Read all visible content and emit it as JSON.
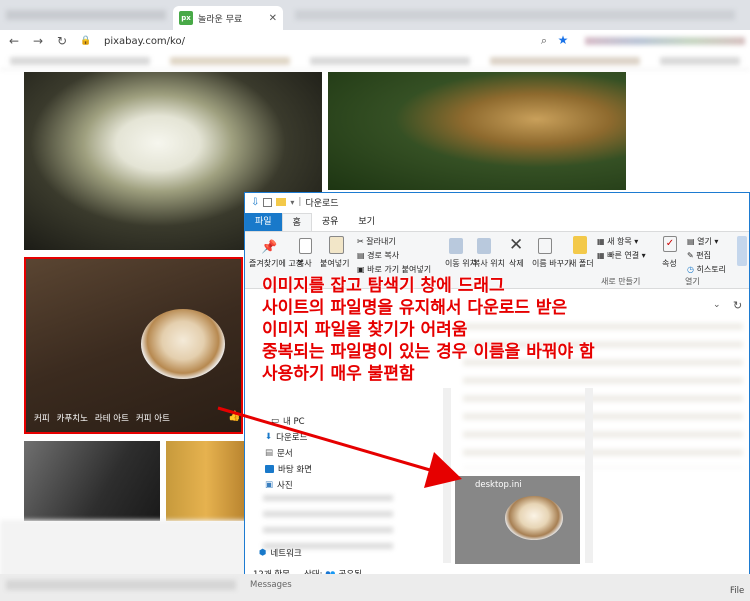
{
  "browser": {
    "tab_title": "놀라운 무료",
    "favicon_text": "px",
    "url": "pixabay.com/ko/"
  },
  "images": {
    "coffee_tags": [
      "커피",
      "카푸치노",
      "라테 아트",
      "커피 아트"
    ]
  },
  "explorer": {
    "title": "다운로드",
    "tabs": [
      "파일",
      "홈",
      "공유",
      "보기"
    ],
    "ribbon": {
      "pin_label": "즐겨찾기에 고정",
      "copy_label": "복사",
      "paste_label": "붙여넣기",
      "cut_label": "잘라내기",
      "copy_path_label": "경로 복사",
      "paste_shortcut_label": "바로 가기 붙여넣기",
      "move_label": "이동 위치",
      "copy_to_label": "복사 위치",
      "delete_label": "삭제",
      "rename_label": "이름 바꾸기",
      "new_folder_label": "새 폴더",
      "new_item_label": "새 항목",
      "easy_access_label": "빠른 연결",
      "new_group_label": "새로 만들기",
      "properties_label": "속성",
      "open_label": "열기",
      "edit_label": "편집",
      "history_label": "히스토리",
      "open_group_label": "열기"
    },
    "sidebar": {
      "this_pc": "내 PC",
      "downloads": "다운로드",
      "documents": "문서",
      "desktop": "바탕 화면",
      "pictures": "사진",
      "network": "네트워크"
    },
    "file_label": "desktop.ini",
    "status": {
      "item_count": "12개 항목",
      "state_label": "상태:",
      "state_value": "공유됨"
    },
    "messages_fragment": "Messages",
    "corner_fragment": "File"
  },
  "annotation": {
    "lines": [
      "이미지를 잡고 탐색기 창에 드래그",
      "사이트의 파일명을 유지해서 다운로드 받은",
      "이미지 파일을 찾기가 어려움",
      "중복되는 파일명이 있는 경우 이름을 바꿔야 함",
      "사용하기 매우 불편함"
    ],
    "color": "#e60000"
  },
  "colors": {
    "accent": "#1979ca",
    "highlight_frame": "#e60000"
  }
}
